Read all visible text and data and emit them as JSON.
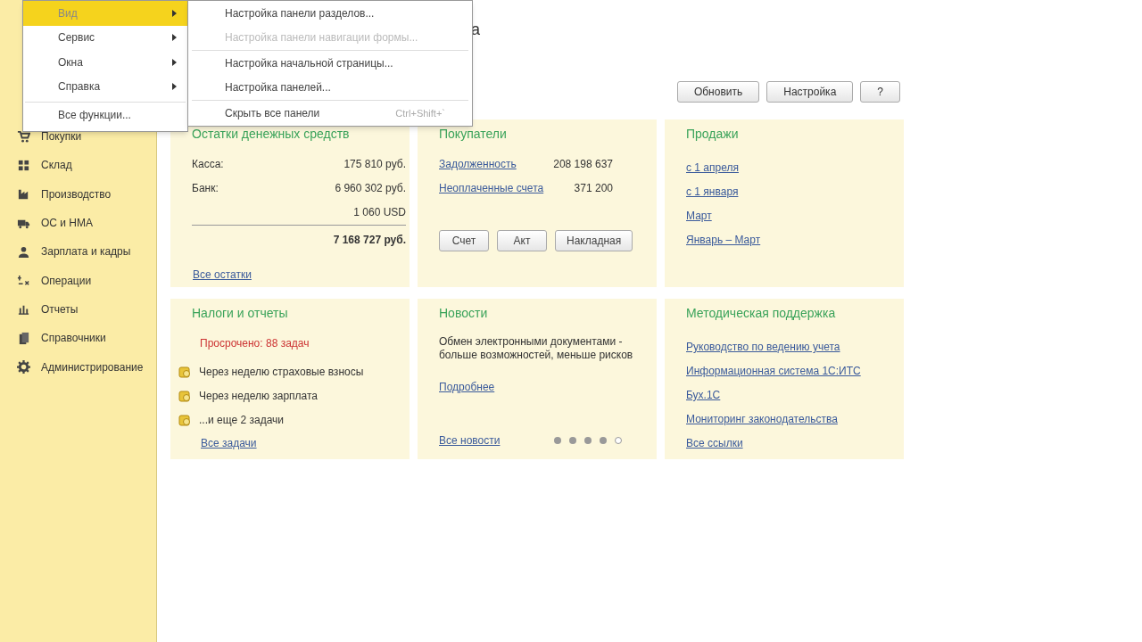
{
  "page_title_fragment": "а",
  "sidebar": {
    "items": [
      {
        "label": "Покупки"
      },
      {
        "label": "Склад"
      },
      {
        "label": "Производство"
      },
      {
        "label": "ОС и НМА"
      },
      {
        "label": "Зарплата и кадры"
      },
      {
        "label": "Операции"
      },
      {
        "label": "Отчеты"
      },
      {
        "label": "Справочники"
      },
      {
        "label": "Администрирование"
      }
    ]
  },
  "main_menu": {
    "items": [
      {
        "label": "Вид",
        "selected": true,
        "kind": "submenu"
      },
      {
        "label": "Сервис",
        "selected": false,
        "kind": "submenu"
      },
      {
        "label": "Окна",
        "selected": false,
        "kind": "submenu"
      },
      {
        "label": "Справка",
        "selected": false,
        "kind": "submenu"
      },
      {
        "label": "Все функции...",
        "selected": false,
        "kind": "command"
      }
    ]
  },
  "submenu": {
    "groups": [
      [
        {
          "label": "Настройка панели разделов...",
          "disabled": false
        },
        {
          "label": "Настройка панели навигации формы...",
          "disabled": true
        }
      ],
      [
        {
          "label": "Настройка начальной страницы...",
          "disabled": false
        },
        {
          "label": "Настройка панелей...",
          "disabled": false
        }
      ],
      [
        {
          "label": "Скрыть все панели",
          "disabled": false,
          "shortcut": "Ctrl+Shift+`"
        }
      ]
    ]
  },
  "toolbar": {
    "buttons": [
      "Обновить",
      "Настройка",
      "?"
    ]
  },
  "cards": [
    {
      "kind": "cash",
      "title": "Остатки денежных средств",
      "rows": [
        {
          "label": "Касса:",
          "value": "175 810 руб."
        },
        {
          "label": "Банк:",
          "value": "6 960 302 руб."
        }
      ],
      "extra": "1 060 USD",
      "total": "7 168 727 руб.",
      "link": "Все остатки"
    },
    {
      "kind": "customers",
      "title": "Покупатели",
      "rows": [
        {
          "link": "Задолженность",
          "value": "208 198 637"
        },
        {
          "link": "Неоплаченные счета",
          "value": "371 200"
        }
      ],
      "buttons": [
        "Счет",
        "Акт",
        "Накладная"
      ]
    },
    {
      "kind": "links",
      "title": "Продажи",
      "links": [
        "с 1 апреля",
        "с 1 января",
        "Март",
        "Январь – Март"
      ]
    },
    {
      "kind": "tasks",
      "title": "Налоги и отчеты",
      "overdue": "Просрочено: 88 задач",
      "tasks": [
        "Через неделю страховые взносы",
        "Через неделю зарплата",
        "...и еще 2 задачи"
      ],
      "link": "Все задачи"
    },
    {
      "kind": "news",
      "title": "Новости",
      "text": "Обмен электронными документами - больше возможностей, меньше рисков",
      "more": "Подробнее",
      "link": "Все новости",
      "dots": [
        {
          "selected": false
        },
        {
          "selected": false
        },
        {
          "selected": false
        },
        {
          "selected": false
        },
        {
          "selected": true
        }
      ]
    },
    {
      "kind": "links",
      "title": "Методическая поддержка",
      "links": [
        "Руководство по ведению учета",
        "Информационная система 1С:ИТС",
        "Бух.1С",
        "Мониторинг законодательства",
        "Все ссылки"
      ]
    }
  ]
}
